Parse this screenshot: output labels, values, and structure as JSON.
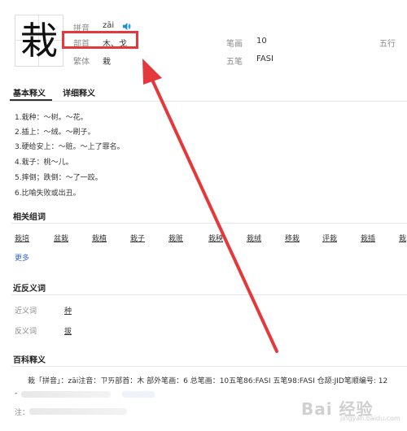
{
  "header": {
    "character": "栽",
    "pinyin_label": "拼音",
    "pinyin_value": "zāi",
    "radical_label": "部首",
    "radical_value": "木、戈",
    "traditional_label": "繁体",
    "traditional_value": "栽",
    "strokes_label": "笔画",
    "strokes_value": "10",
    "wuxing_label": "五行",
    "wubi_label": "五笔",
    "wubi_value": "FASI"
  },
  "tabs": [
    {
      "label": "基本释义"
    },
    {
      "label": "详细释义"
    }
  ],
  "definitions": [
    "1.栽种：～树。～花。",
    "2.插上：～绒。～刷子。",
    "3.硬给安上：～赃。～上了罪名。",
    "4.栽子：桃～儿。",
    "5.摔倒；跌倒：～了一跤。",
    "6.比喻失败或出丑。"
  ],
  "related": {
    "title": "相关组词",
    "words": [
      "栽培",
      "盆栽",
      "栽植",
      "栽子",
      "栽赃",
      "栽秧",
      "栽绒",
      "移栽",
      "评栽",
      "栽插",
      "栽"
    ],
    "more": "更多"
  },
  "synonyms": {
    "title": "近反义词",
    "syn_label": "近义词",
    "syn_value": "种",
    "ant_label": "反义词",
    "ant_value": "拔"
  },
  "baike": {
    "title": "百科释义",
    "text": "栽「拼音」：zāi注音：ㄗㄞ部首：木 部外笔画：6 总笔画：10五笔86:FASI 五笔98:FASI 仓颉:JID笔顺编号: 12",
    "note_prefix": "注："
  },
  "watermark": {
    "text": "Bai 经验",
    "sub": "jingyan.baidu.com"
  },
  "colors": {
    "highlight": "#e4393c",
    "link": "#3366cc",
    "speaker": "#1a8fd8"
  }
}
